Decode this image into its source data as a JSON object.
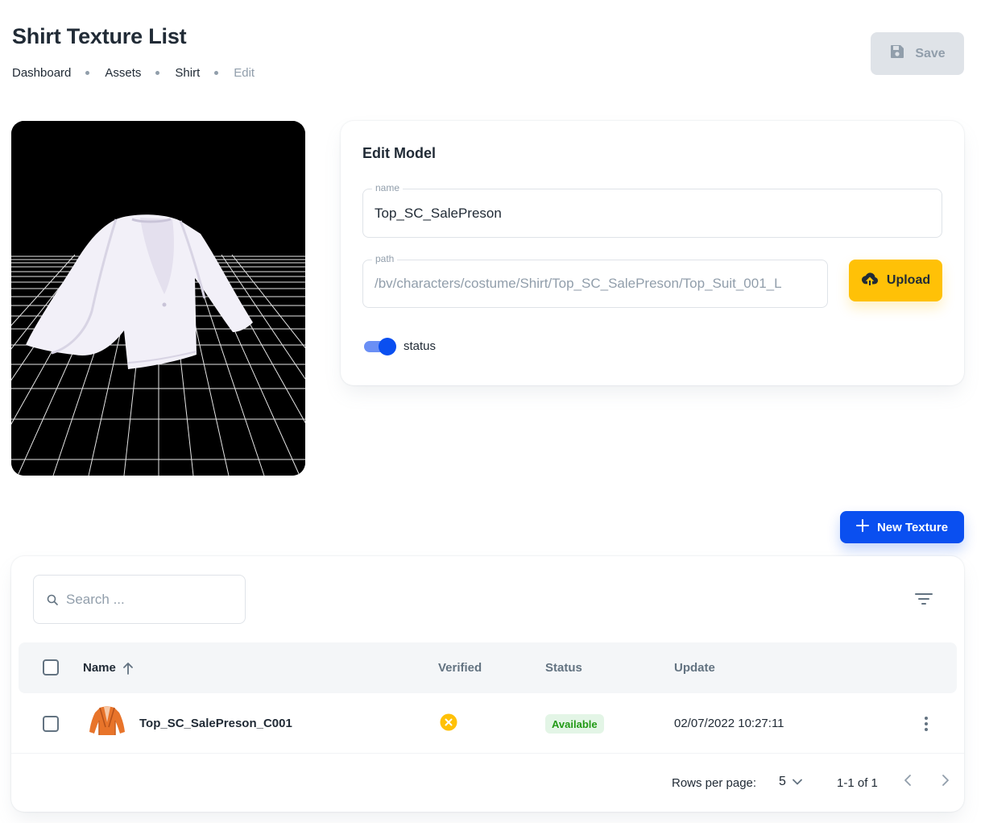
{
  "header": {
    "title": "Shirt Texture List",
    "breadcrumb": [
      "Dashboard",
      "Assets",
      "Shirt",
      "Edit"
    ],
    "save_label": "Save"
  },
  "edit_model": {
    "title": "Edit Model",
    "name_label": "name",
    "name_value": "Top_SC_SalePreson",
    "path_label": "path",
    "path_value": "/bv/characters/costume/Shirt/Top_SC_SalePreson/Top_Suit_001_L",
    "upload_label": "Upload",
    "status_label": "status",
    "status_on": true
  },
  "new_texture_label": "New Texture",
  "table": {
    "search_placeholder": "Search ...",
    "columns": {
      "name": "Name",
      "verified": "Verified",
      "status": "Status",
      "update": "Update"
    },
    "rows": [
      {
        "name": "Top_SC_SalePreson_C001",
        "verified": false,
        "status": "Available",
        "update": "02/07/2022 10:27:11"
      }
    ],
    "footer": {
      "rows_per_page_label": "Rows per page:",
      "rows_per_page_value": "5",
      "range": "1-1 of 1"
    }
  },
  "colors": {
    "primary": "#0a4ff0",
    "warning": "#ffc107",
    "success_text": "#229a16",
    "success_bg": "#e3f5e6",
    "disabled_bg": "#dfe3e8"
  }
}
